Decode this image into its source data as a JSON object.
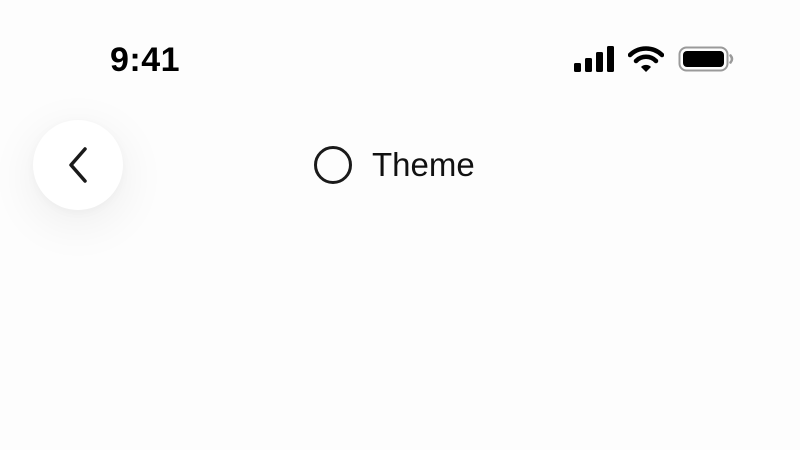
{
  "status_bar": {
    "time": "9:41",
    "icons": [
      "cellular-signal-icon",
      "wifi-icon",
      "battery-icon"
    ]
  },
  "nav": {
    "back_icon": "chevron-left-icon",
    "title": "Theme",
    "title_icon": "radio-unselected-icon"
  },
  "colors": {
    "background": "#fdfdfd",
    "text": "#111111",
    "button_background": "#ffffff"
  }
}
